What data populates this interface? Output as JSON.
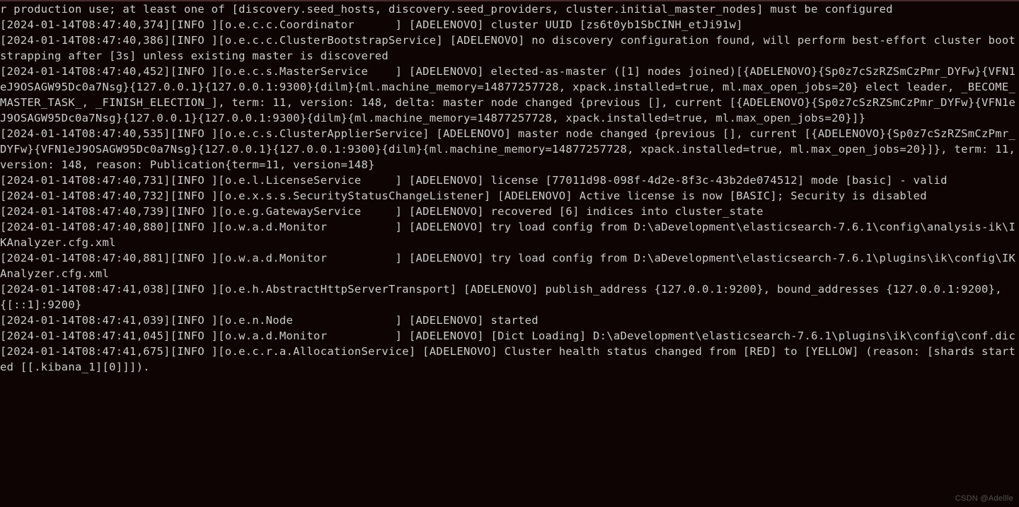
{
  "terminal": {
    "lines": [
      "r production use; at least one of [discovery.seed_hosts, discovery.seed_providers, cluster.initial_master_nodes] must be configured",
      "[2024-01-14T08:47:40,374][INFO ][o.e.c.c.Coordinator      ] [ADELENOVO] cluster UUID [zs6t0yb1SbCINH_etJi91w]",
      "[2024-01-14T08:47:40,386][INFO ][o.e.c.c.ClusterBootstrapService] [ADELENOVO] no discovery configuration found, will perform best-effort cluster bootstrapping after [3s] unless existing master is discovered",
      "[2024-01-14T08:47:40,452][INFO ][o.e.c.s.MasterService    ] [ADELENOVO] elected-as-master ([1] nodes joined)[{ADELENOVO}{Sp0z7cSzRZSmCzPmr_DYFw}{VFN1eJ9OSAGW95Dc0a7Nsg}{127.0.0.1}{127.0.0.1:9300}{dilm}{ml.machine_memory=14877257728, xpack.installed=true, ml.max_open_jobs=20} elect leader, _BECOME_MASTER_TASK_, _FINISH_ELECTION_], term: 11, version: 148, delta: master node changed {previous [], current [{ADELENOVO}{Sp0z7cSzRZSmCzPmr_DYFw}{VFN1eJ9OSAGW95Dc0a7Nsg}{127.0.0.1}{127.0.0.1:9300}{dilm}{ml.machine_memory=14877257728, xpack.installed=true, ml.max_open_jobs=20}]}",
      "[2024-01-14T08:47:40,535][INFO ][o.e.c.s.ClusterApplierService] [ADELENOVO] master node changed {previous [], current [{ADELENOVO}{Sp0z7cSzRZSmCzPmr_DYFw}{VFN1eJ9OSAGW95Dc0a7Nsg}{127.0.0.1}{127.0.0.1:9300}{dilm}{ml.machine_memory=14877257728, xpack.installed=true, ml.max_open_jobs=20}]}, term: 11, version: 148, reason: Publication{term=11, version=148}",
      "[2024-01-14T08:47:40,731][INFO ][o.e.l.LicenseService     ] [ADELENOVO] license [77011d98-098f-4d2e-8f3c-43b2de074512] mode [basic] - valid",
      "[2024-01-14T08:47:40,732][INFO ][o.e.x.s.s.SecurityStatusChangeListener] [ADELENOVO] Active license is now [BASIC]; Security is disabled",
      "[2024-01-14T08:47:40,739][INFO ][o.e.g.GatewayService     ] [ADELENOVO] recovered [6] indices into cluster_state",
      "[2024-01-14T08:47:40,880][INFO ][o.w.a.d.Monitor          ] [ADELENOVO] try load config from D:\\aDevelopment\\elasticsearch-7.6.1\\config\\analysis-ik\\IKAnalyzer.cfg.xml",
      "[2024-01-14T08:47:40,881][INFO ][o.w.a.d.Monitor          ] [ADELENOVO] try load config from D:\\aDevelopment\\elasticsearch-7.6.1\\plugins\\ik\\config\\IKAnalyzer.cfg.xml",
      "[2024-01-14T08:47:41,038][INFO ][o.e.h.AbstractHttpServerTransport] [ADELENOVO] publish_address {127.0.0.1:9200}, bound_addresses {127.0.0.1:9200}, {[::1]:9200}",
      "[2024-01-14T08:47:41,039][INFO ][o.e.n.Node               ] [ADELENOVO] started",
      "[2024-01-14T08:47:41,045][INFO ][o.w.a.d.Monitor          ] [ADELENOVO] [Dict Loading] D:\\aDevelopment\\elasticsearch-7.6.1\\plugins\\ik\\config\\conf.dic",
      "[2024-01-14T08:47:41,675][INFO ][o.e.c.r.a.AllocationService] [ADELENOVO] Cluster health status changed from [RED] to [YELLOW] (reason: [shards started [[.kibana_1][0]]])."
    ]
  },
  "watermark": "CSDN @Adellle"
}
